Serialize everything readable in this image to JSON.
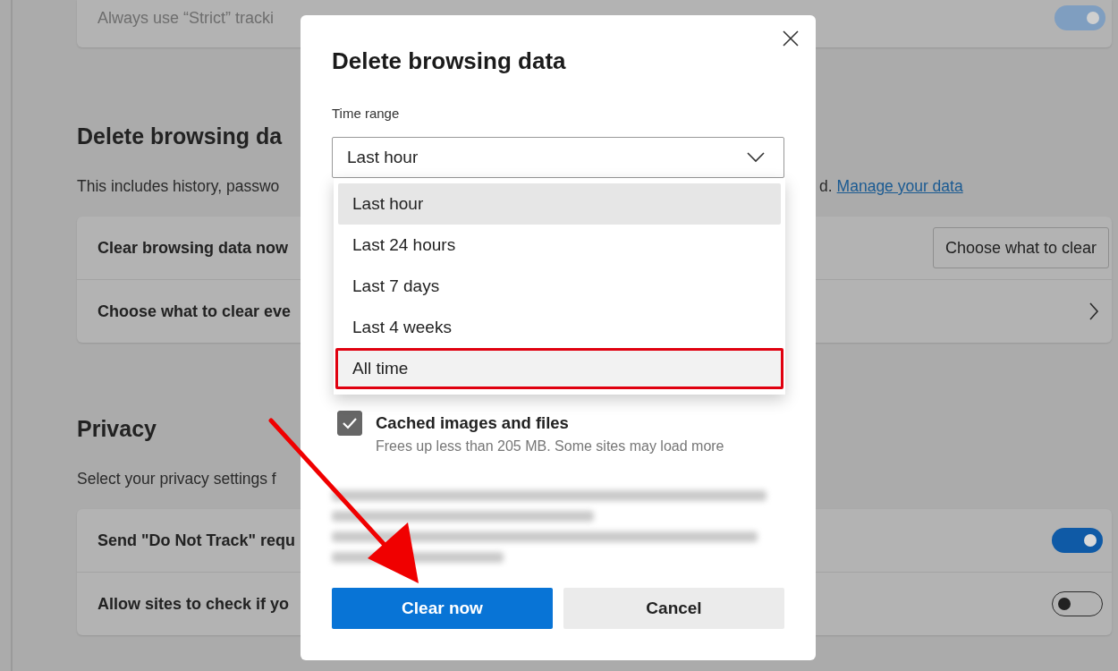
{
  "background": {
    "top_row": {
      "label": "Always use “Strict” tracki",
      "on": true
    },
    "sections": [
      {
        "heading": "Delete browsing da",
        "description": "This includes history, passwo",
        "description_end": "d.",
        "link": "Manage your data",
        "rows": [
          {
            "kind": "button",
            "label": "Clear browsing data now",
            "button": "Choose what to clear"
          },
          {
            "kind": "chevron",
            "label": "Choose what to clear eve"
          }
        ]
      },
      {
        "heading": "Privacy",
        "description": "Select your privacy settings f",
        "rows": [
          {
            "kind": "toggle",
            "label": "Send \"Do Not Track\" requ",
            "on": true
          },
          {
            "kind": "toggle",
            "label": "Allow sites to check if yo",
            "on": false
          }
        ]
      }
    ]
  },
  "dialog": {
    "title": "Delete browsing data",
    "time_range": {
      "label": "Time range",
      "value": "Last hour",
      "options": [
        {
          "label": "Last hour",
          "selected": true,
          "highlighted": false
        },
        {
          "label": "Last 24 hours",
          "selected": false,
          "highlighted": false
        },
        {
          "label": "Last 7 days",
          "selected": false,
          "highlighted": false
        },
        {
          "label": "Last 4 weeks",
          "selected": false,
          "highlighted": false
        },
        {
          "label": "All time",
          "selected": false,
          "highlighted": true
        }
      ]
    },
    "items": [
      {
        "label": "Cached images and files",
        "description": "Frees up less than 205 MB. Some sites may load more",
        "checked": true
      }
    ],
    "buttons": [
      {
        "label": "Clear now",
        "kind": "primary"
      },
      {
        "label": "Cancel",
        "kind": "secondary"
      }
    ]
  }
}
